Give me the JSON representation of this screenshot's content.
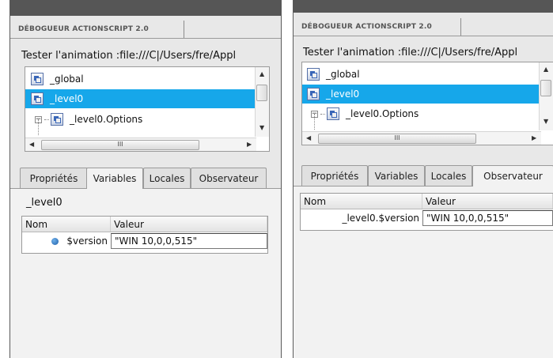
{
  "panels": [
    {
      "title": "DÉBOGUEUR ACTIONSCRIPT 2.0",
      "url_line": "Tester l'animation :file:///C|/Users/fre/Appl",
      "tree": [
        "_global",
        "_level0",
        "_level0.Options"
      ],
      "hscroll_label": "III",
      "tabs": [
        "Propriétés",
        "Variables",
        "Locales",
        "Observateur"
      ],
      "active_tab": "Variables",
      "target": "_level0",
      "columns": [
        "Nom",
        "Valeur"
      ],
      "rows": [
        {
          "name": "$version",
          "value": "\"WIN 10,0,0,515\""
        }
      ]
    },
    {
      "title": "DÉBOGUEUR ACTIONSCRIPT 2.0",
      "url_line": "Tester l'animation :file:///C|/Users/fre/Appl",
      "tree": [
        "_global",
        "_level0",
        "_level0.Options"
      ],
      "hscroll_label": "III",
      "tabs": [
        "Propriétés",
        "Variables",
        "Locales",
        "Observateur"
      ],
      "active_tab": "Observateur",
      "columns": [
        "Nom",
        "Valeur"
      ],
      "rows": [
        {
          "name": "_level0.$version",
          "value": "\"WIN 10,0,0,515\""
        }
      ]
    }
  ],
  "colors": {
    "selection": "#16a7ea",
    "panel_bg": "#e8e8e8",
    "frame_dark": "#565656"
  },
  "icons": [
    "movieclip-icon",
    "variable-dot-icon",
    "tree-expander-icon",
    "scroll-arrow-icon"
  ]
}
